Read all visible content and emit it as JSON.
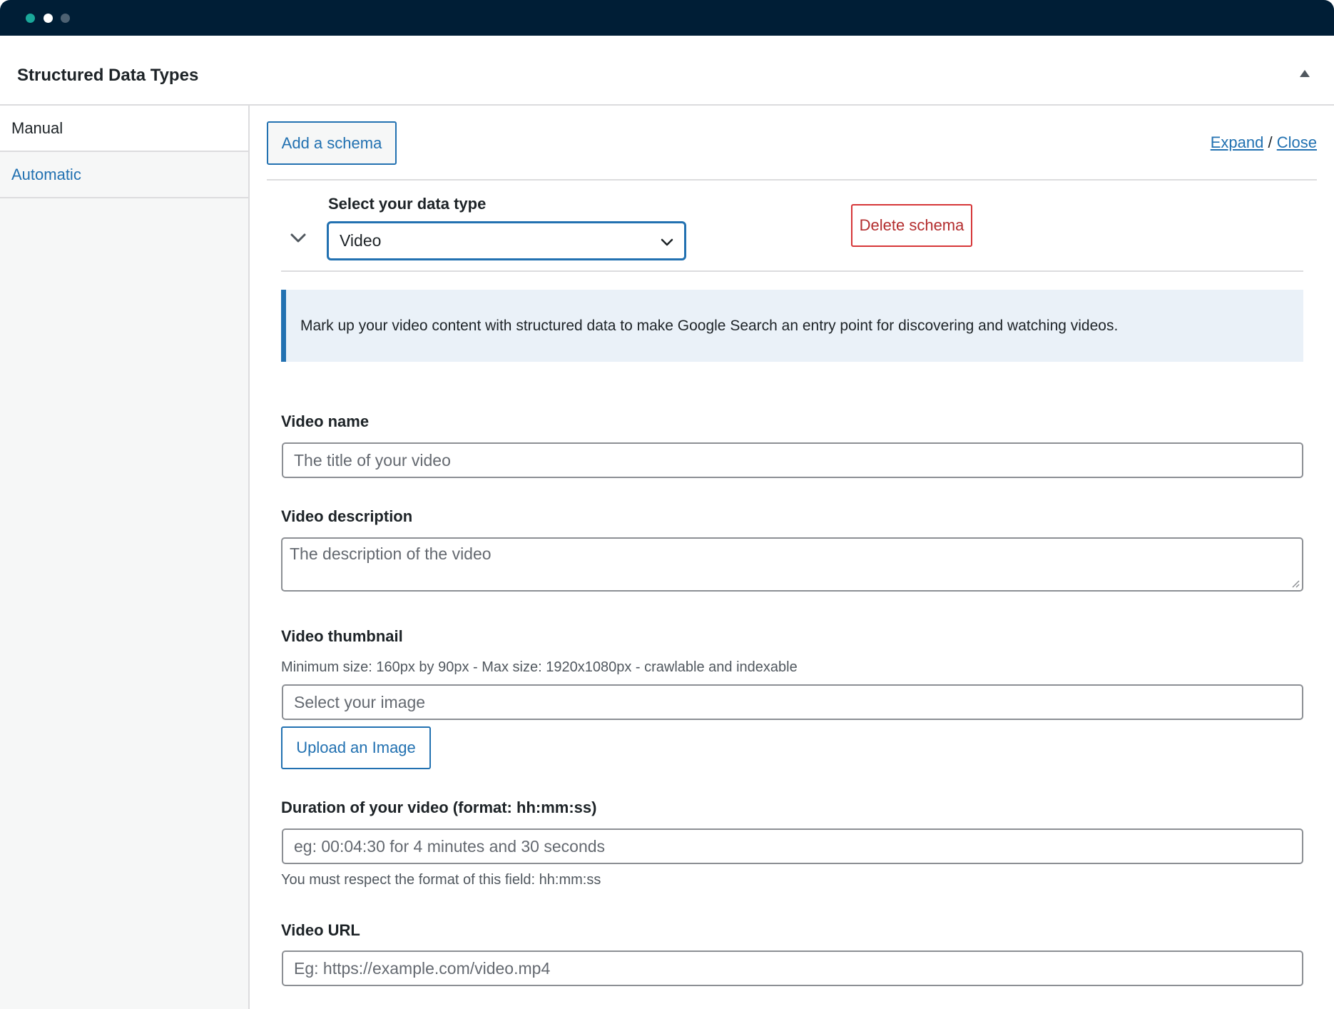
{
  "panel": {
    "title": "Structured Data Types"
  },
  "sidebar": {
    "items": [
      {
        "label": "Manual"
      },
      {
        "label": "Automatic"
      }
    ]
  },
  "toolbar": {
    "add_schema_label": "Add a schema",
    "expand_label": "Expand",
    "separator": "/",
    "close_label": "Close"
  },
  "schema": {
    "data_type_label": "Select your data type",
    "data_type_value": "Video",
    "delete_label": "Delete schema",
    "notice": "Mark up your video content with structured data to make Google Search an entry point for discovering and watching videos."
  },
  "fields": {
    "video_name": {
      "label": "Video name",
      "placeholder": "The title of your video"
    },
    "video_description": {
      "label": "Video description",
      "placeholder": "The description of the video"
    },
    "video_thumbnail": {
      "label": "Video thumbnail",
      "help": "Minimum size: 160px by 90px - Max size: 1920x1080px - crawlable and indexable",
      "placeholder": "Select your image",
      "upload_label": "Upload an Image"
    },
    "duration": {
      "label": "Duration of your video (format: hh:mm:ss)",
      "placeholder": "eg: 00:04:30 for 4 minutes and 30 seconds",
      "help": "You must respect the format of this field: hh:mm:ss"
    },
    "video_url": {
      "label": "Video URL",
      "placeholder": "Eg: https://example.com/video.mp4"
    }
  },
  "colors": {
    "titlebar": "#001e36",
    "accent": "#2271b1",
    "danger": "#b32d2e",
    "notice_bg": "#eaf1f8"
  }
}
